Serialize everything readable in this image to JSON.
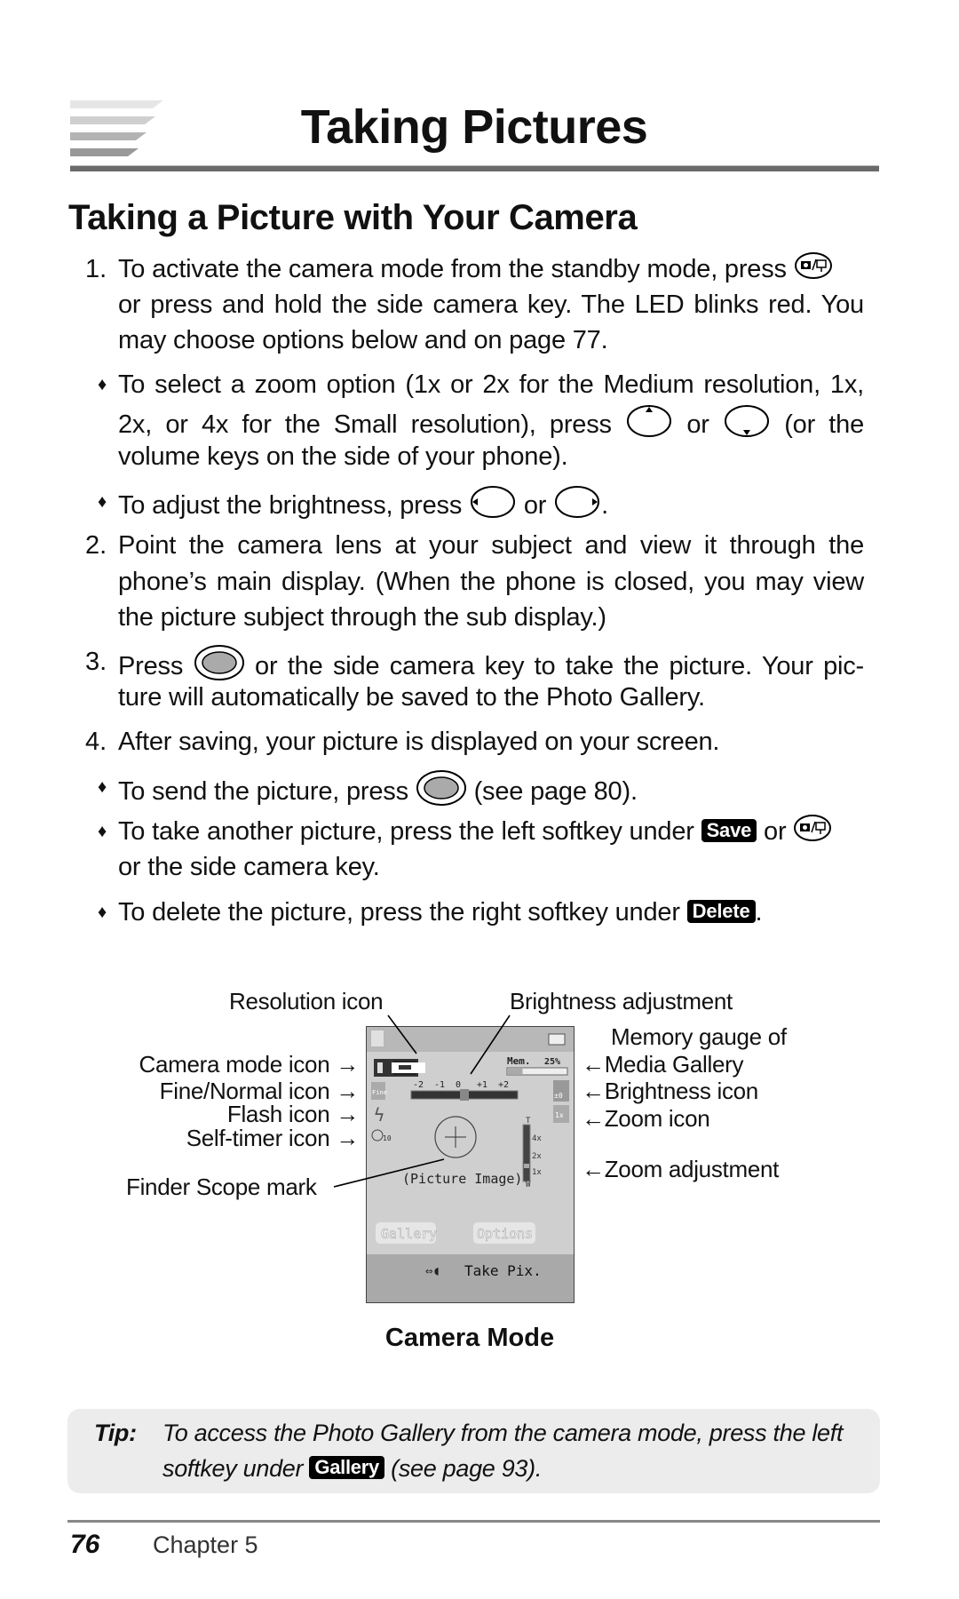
{
  "header": {
    "title": "Taking Pictures"
  },
  "section": {
    "title": "Taking a Picture with Your Camera"
  },
  "body": {
    "lines": [
      {
        "marker": "1.",
        "segs": [
          {
            "t": "To activate the camera mode from the standby mode, press "
          },
          {
            "icon": "camera-key"
          }
        ]
      },
      {
        "segs": [
          {
            "t": "or press and hold the side camera key. The LED blinks red. You"
          }
        ],
        "justify": true
      },
      {
        "segs": [
          {
            "t": "may choose options below and on page 77."
          }
        ]
      },
      {
        "marker": "♦",
        "segs": [
          {
            "t": "To select a zoom option (1x or 2x for the Medium resolution, 1x,"
          }
        ],
        "justify": true
      },
      {
        "segs": [
          {
            "t": "2x, or 4x for the Small resolution), press"
          },
          {
            "icon": "nav-up"
          },
          {
            "t": "or"
          },
          {
            "icon": "nav-down"
          },
          {
            "t": "(or the"
          }
        ],
        "justify": true
      },
      {
        "segs": [
          {
            "t": "volume keys on the side of your phone)."
          }
        ]
      },
      {
        "marker": "♦",
        "segs": [
          {
            "t": "To adjust the brightness, press "
          },
          {
            "icon": "nav-left"
          },
          {
            "t": " or "
          },
          {
            "icon": "nav-right"
          },
          {
            "t": "."
          }
        ]
      },
      {
        "marker": "2.",
        "segs": [
          {
            "t": "Point the camera lens at your subject and view it through the"
          }
        ],
        "justify": true
      },
      {
        "segs": [
          {
            "t": "phone’s main display. (When the phone is closed, you may view"
          }
        ],
        "justify": true
      },
      {
        "segs": [
          {
            "t": "the picture subject through the sub display.)"
          }
        ]
      },
      {
        "marker": "3.",
        "segs": [
          {
            "t": "Press"
          },
          {
            "icon": "center-key"
          },
          {
            "t": "or the side camera key to take the picture. Your pic-"
          }
        ],
        "justify": true
      },
      {
        "segs": [
          {
            "t": "ture will automatically be saved to the Photo Gallery."
          }
        ]
      },
      {
        "marker": "4.",
        "segs": [
          {
            "t": "After saving, your picture is displayed on your screen."
          }
        ]
      },
      {
        "marker": "♦",
        "segs": [
          {
            "t": "To send the picture, press "
          },
          {
            "icon": "center-key"
          },
          {
            "t": " (see page 80)."
          }
        ]
      },
      {
        "marker": "♦",
        "segs": [
          {
            "t": "To take another picture, press the left softkey under "
          },
          {
            "badge": "Save"
          },
          {
            "t": " or "
          },
          {
            "icon": "camera-key"
          }
        ]
      },
      {
        "segs": [
          {
            "t": "or the side camera key."
          }
        ]
      },
      {
        "marker": "♦",
        "segs": [
          {
            "t": "To delete the picture, press the right softkey under "
          },
          {
            "badge": "Delete"
          },
          {
            "t": "."
          }
        ]
      }
    ]
  },
  "figure": {
    "labels": {
      "resolution_icon": "Resolution icon",
      "brightness_adjustment": "Brightness adjustment",
      "memory_gauge_1": "Memory gauge of",
      "memory_gauge_2": "Media Gallery",
      "brightness_icon": "Brightness icon",
      "zoom_icon": "Zoom icon",
      "zoom_adjustment": "Zoom adjustment",
      "camera_mode_icon": "Camera mode icon",
      "fine_normal_icon": "Fine/Normal icon",
      "flash_icon": "Flash icon",
      "self_timer_icon": "Self-timer icon",
      "finder_scope_mark": "Finder Scope mark"
    },
    "screen": {
      "mem_label": "Mem.",
      "mem_percent": "25%",
      "mem_level": 0.25,
      "fine": "Fine",
      "brightness_scale": [
        "-2",
        "-1",
        "0",
        "+1",
        "+2"
      ],
      "brightness_value": "±0",
      "zoom_value": "1x",
      "timer": "10",
      "zoom_scale": [
        "T",
        "4x",
        "2x",
        "1x",
        "W"
      ],
      "picture_placeholder": "(Picture Image)",
      "left_softkey": "Gallery",
      "right_softkey": "Options",
      "center_action": "Take Pix."
    },
    "caption": "Camera Mode"
  },
  "tip": {
    "label": "Tip:",
    "line1": "To access the Photo Gallery from the camera mode, press the left",
    "line2_pre": "softkey under",
    "badge": "Gallery",
    "line2_post": "(see page 93)."
  },
  "footer": {
    "page_number": "76",
    "chapter": "Chapter 5"
  }
}
